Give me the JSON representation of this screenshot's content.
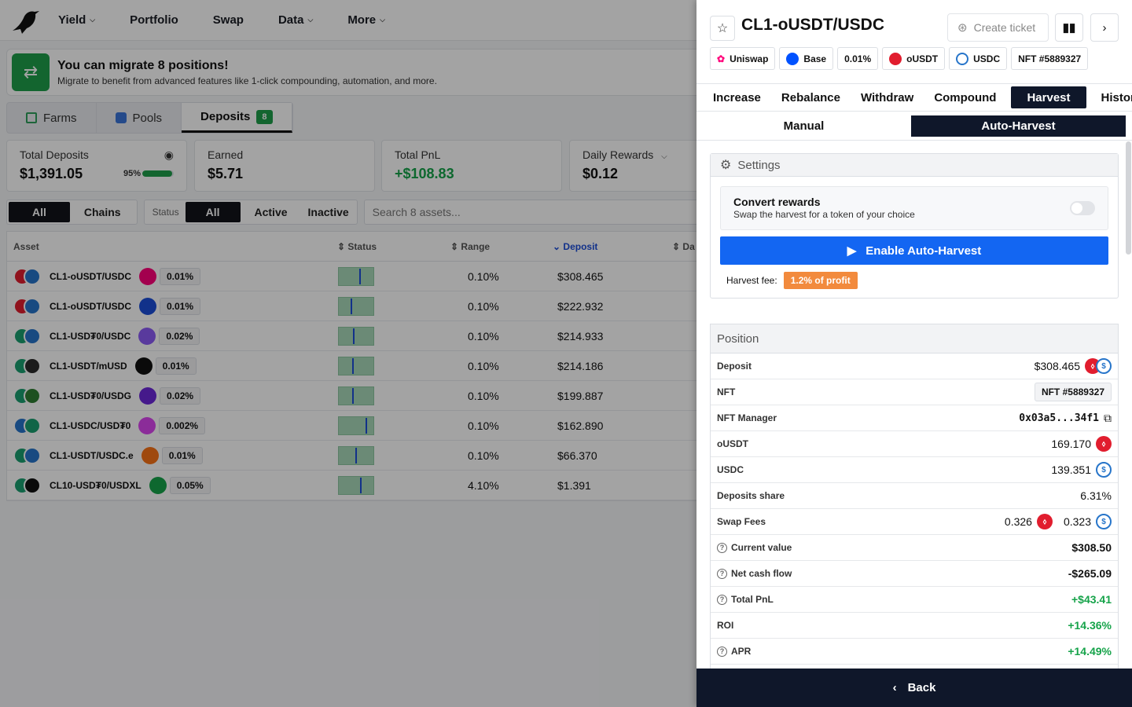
{
  "nav": {
    "items": [
      {
        "label": "Yield",
        "dropdown": true
      },
      {
        "label": "Portfolio",
        "dropdown": false
      },
      {
        "label": "Swap",
        "dropdown": false
      },
      {
        "label": "Data",
        "dropdown": true
      },
      {
        "label": "More",
        "dropdown": true
      }
    ]
  },
  "banner": {
    "title": "You can migrate 8 positions!",
    "subtitle": "Migrate to benefit from advanced features like 1-click compounding, automation, and more."
  },
  "subtabs": {
    "farms": "Farms",
    "pools": "Pools",
    "deposits": "Deposits",
    "deposits_count": "8"
  },
  "stats": {
    "total_deposits_label": "Total Deposits",
    "total_deposits_value": "$1,391.05",
    "total_deposits_pct": "95%",
    "total_deposits_progress": 0.95,
    "earned_label": "Earned",
    "earned_value": "$5.71",
    "pnl_label": "Total PnL",
    "pnl_value": "+$108.83",
    "daily_label": "Daily Rewards",
    "daily_value": "$0.12"
  },
  "filters": {
    "all": "All",
    "chains": "Chains",
    "status_label": "Status",
    "status_all": "All",
    "active": "Active",
    "inactive": "Inactive",
    "search_placeholder": "Search 8 assets..."
  },
  "table": {
    "headers": {
      "asset": "Asset",
      "status": "Status",
      "range": "Range",
      "deposit": "Deposit",
      "da": "Da"
    },
    "rows": [
      {
        "name": "CL1-oUSDT/USDC",
        "fee": "0.01%",
        "range": "0.10%",
        "deposit": "$308.465",
        "mark": 0.62
      },
      {
        "name": "CL1-oUSDT/USDC",
        "fee": "0.01%",
        "range": "0.10%",
        "deposit": "$222.932",
        "mark": 0.35
      },
      {
        "name": "CL1-USD₮0/USDC",
        "fee": "0.02%",
        "range": "0.10%",
        "deposit": "$214.933",
        "mark": 0.42
      },
      {
        "name": "CL1-USDT/mUSD",
        "fee": "0.01%",
        "range": "0.10%",
        "deposit": "$214.186",
        "mark": 0.4
      },
      {
        "name": "CL1-USD₮0/USDG",
        "fee": "0.02%",
        "range": "0.10%",
        "deposit": "$199.887",
        "mark": 0.4
      },
      {
        "name": "CL1-USDC/USD₮0",
        "fee": "0.002%",
        "range": "0.10%",
        "deposit": "$162.890",
        "mark": 0.82
      },
      {
        "name": "CL1-USDT/USDC.e",
        "fee": "0.01%",
        "range": "0.10%",
        "deposit": "$66.370",
        "mark": 0.5
      },
      {
        "name": "CL10-USD₮0/USDXL",
        "fee": "0.05%",
        "range": "4.10%",
        "deposit": "$1.391",
        "mark": 0.64
      }
    ]
  },
  "panel": {
    "title": "CL1-oUSDT/USDC",
    "create_ticket": "Create ticket",
    "chips": {
      "dex": "Uniswap",
      "chain": "Base",
      "fee": "0.01%",
      "token0": "oUSDT",
      "token1": "USDC",
      "nft": "NFT #5889327"
    },
    "tabs": [
      "Increase",
      "Rebalance",
      "Withdraw",
      "Compound",
      "Harvest",
      "History"
    ],
    "modes": {
      "manual": "Manual",
      "auto": "Auto-Harvest"
    },
    "settings": {
      "title": "Settings",
      "convert_title": "Convert rewards",
      "convert_sub": "Swap the harvest for a token of your choice",
      "convert_enabled": false,
      "enable_button": "Enable Auto-Harvest",
      "fee_label": "Harvest fee:",
      "fee_value": "1.2% of profit"
    },
    "position": {
      "title": "Position",
      "deposit_label": "Deposit",
      "deposit_value": "$308.465",
      "nft_label": "NFT",
      "nft_value": "NFT #5889327",
      "manager_label": "NFT Manager",
      "manager_value": "0x03a5...34f1",
      "token0_label": "oUSDT",
      "token0_value": "169.170",
      "token1_label": "USDC",
      "token1_value": "139.351",
      "share_label": "Deposits share",
      "share_value": "6.31%",
      "fees_label": "Swap Fees",
      "fees0": "0.326",
      "fees1": "0.323",
      "current_label": "Current value",
      "current_value": "$308.50",
      "ncf_label": "Net cash flow",
      "ncf_value": "-$265.09",
      "pnl_label": "Total PnL",
      "pnl_value": "+$43.41",
      "roi_label": "ROI",
      "roi_value": "+14.36%",
      "apr_label": "APR",
      "apr_value": "+14.49%"
    },
    "back": "Back"
  },
  "colors": {
    "accent_blue": "#1366f2",
    "green": "#16a34a",
    "dark": "#0f172a",
    "fee_orange": "#f28a3d"
  }
}
